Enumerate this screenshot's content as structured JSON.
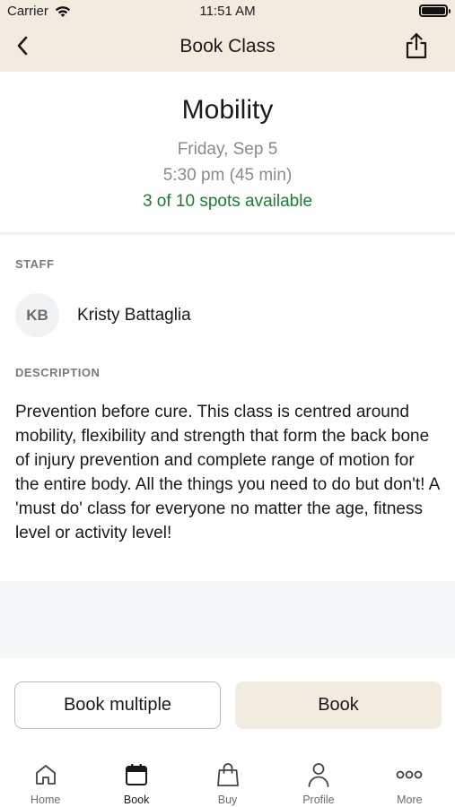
{
  "status_bar": {
    "carrier": "Carrier",
    "time": "11:51 AM",
    "battery_level": 1.0
  },
  "nav": {
    "title": "Book Class",
    "back_icon": "chevron-left-icon",
    "share_icon": "share-icon"
  },
  "class_info": {
    "name": "Mobility",
    "date": "Friday, Sep 5",
    "time": "5:30 pm (45 min)",
    "availability": "3 of 10 spots available",
    "availability_color": "#1b7e2e"
  },
  "staff": {
    "section_label": "STAFF",
    "initials": "KB",
    "name": "Kristy Battaglia"
  },
  "description": {
    "section_label": "DESCRIPTION",
    "text": "Prevention before cure.  This class is centred around mobility, flexibility and strength that form the back bone of injury prevention and complete range of motion for the entire body.  All the things you need to do but don't!   A 'must do' class for everyone no matter the age, fitness level or activity level!"
  },
  "actions": {
    "book_multiple_label": "Book multiple",
    "book_label": "Book"
  },
  "tabs": [
    {
      "label": "Home",
      "icon": "home-icon",
      "active": false
    },
    {
      "label": "Book",
      "icon": "calendar-icon",
      "active": true
    },
    {
      "label": "Buy",
      "icon": "shopping-bag-icon",
      "active": false
    },
    {
      "label": "Profile",
      "icon": "person-icon",
      "active": false
    },
    {
      "label": "More",
      "icon": "more-dots-icon",
      "active": false
    }
  ],
  "colors": {
    "accent": "#f2ebe0",
    "muted_text": "#8a8a8a",
    "section_bg": "#f6f7f9"
  }
}
